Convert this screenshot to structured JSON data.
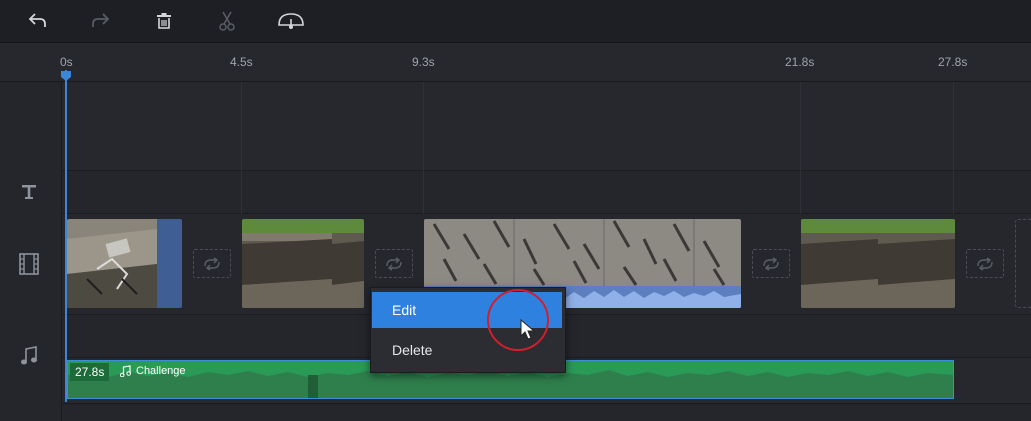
{
  "toolbar": {
    "buttons": [
      {
        "name": "undo",
        "icon": "undo-icon",
        "enabled": true
      },
      {
        "name": "redo",
        "icon": "redo-icon",
        "enabled": false
      },
      {
        "name": "delete",
        "icon": "trash-icon",
        "enabled": true
      },
      {
        "name": "split",
        "icon": "scissors-icon",
        "enabled": false
      },
      {
        "name": "speed",
        "icon": "speedometer-icon",
        "enabled": true
      }
    ]
  },
  "ruler": {
    "ticks": [
      "0s",
      "4.5s",
      "9.3s",
      "21.8s",
      "27.8s"
    ]
  },
  "tracks": {
    "text_icon": "text-track-icon",
    "video_icon": "film-track-icon",
    "music_icon": "music-track-icon"
  },
  "music_clip": {
    "duration": "27.8s",
    "title": "Challenge",
    "color": "#2a9a57"
  },
  "context_menu": {
    "items": [
      {
        "label": "Edit",
        "highlighted": true
      },
      {
        "label": "Delete",
        "highlighted": false
      }
    ]
  },
  "colors": {
    "accent": "#2f81e0",
    "playhead": "#3b86d9",
    "highlight_ring": "#d11f2b"
  }
}
